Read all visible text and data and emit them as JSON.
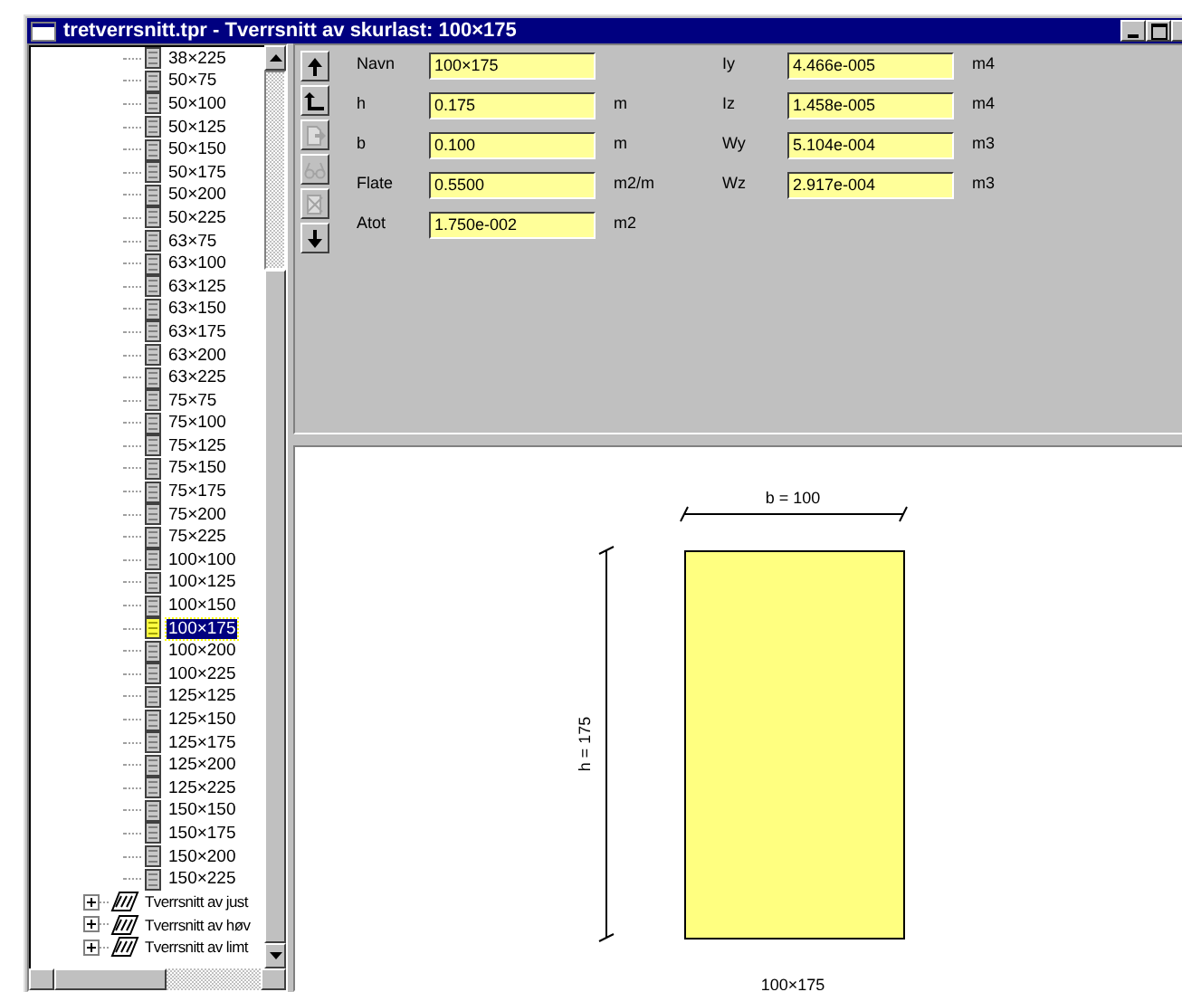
{
  "window": {
    "title": "tretverrsnitt.tpr - Tverrsnitt av skurlast: 100×175"
  },
  "sections": [
    {
      "label": "38×225",
      "selected": false
    },
    {
      "label": "50×75",
      "selected": false
    },
    {
      "label": "50×100",
      "selected": false
    },
    {
      "label": "50×125",
      "selected": false
    },
    {
      "label": "50×150",
      "selected": false
    },
    {
      "label": "50×175",
      "selected": false
    },
    {
      "label": "50×200",
      "selected": false
    },
    {
      "label": "50×225",
      "selected": false
    },
    {
      "label": "63×75",
      "selected": false
    },
    {
      "label": "63×100",
      "selected": false
    },
    {
      "label": "63×125",
      "selected": false
    },
    {
      "label": "63×150",
      "selected": false
    },
    {
      "label": "63×175",
      "selected": false
    },
    {
      "label": "63×200",
      "selected": false
    },
    {
      "label": "63×225",
      "selected": false
    },
    {
      "label": "75×75",
      "selected": false
    },
    {
      "label": "75×100",
      "selected": false
    },
    {
      "label": "75×125",
      "selected": false
    },
    {
      "label": "75×150",
      "selected": false
    },
    {
      "label": "75×175",
      "selected": false
    },
    {
      "label": "75×200",
      "selected": false
    },
    {
      "label": "75×225",
      "selected": false
    },
    {
      "label": "100×100",
      "selected": false
    },
    {
      "label": "100×125",
      "selected": false
    },
    {
      "label": "100×150",
      "selected": false
    },
    {
      "label": "100×175",
      "selected": true
    },
    {
      "label": "100×200",
      "selected": false
    },
    {
      "label": "100×225",
      "selected": false
    },
    {
      "label": "125×125",
      "selected": false
    },
    {
      "label": "125×150",
      "selected": false
    },
    {
      "label": "125×175",
      "selected": false
    },
    {
      "label": "125×200",
      "selected": false
    },
    {
      "label": "125×225",
      "selected": false
    },
    {
      "label": "150×150",
      "selected": false
    },
    {
      "label": "150×175",
      "selected": false
    },
    {
      "label": "150×200",
      "selected": false
    },
    {
      "label": "150×225",
      "selected": false
    }
  ],
  "folders": [
    {
      "label": "Tverrsnitt av just",
      "expanded": false
    },
    {
      "label": "Tverrsnitt av høv",
      "expanded": false
    },
    {
      "label": "Tverrsnitt av limt",
      "expanded": false
    }
  ],
  "toolbar": [
    {
      "kind": "up",
      "disabled": false
    },
    {
      "kind": "return",
      "disabled": false
    },
    {
      "kind": "export",
      "disabled": true
    },
    {
      "kind": "glasses",
      "disabled": true
    },
    {
      "kind": "delete",
      "disabled": true
    },
    {
      "kind": "down",
      "disabled": false
    }
  ],
  "fields_left": [
    {
      "label": "Navn",
      "value": "100×175"
    },
    {
      "label": "h",
      "value": "0.175",
      "unit": "m"
    },
    {
      "label": "b",
      "value": "0.100",
      "unit": "m"
    },
    {
      "label": "Flate",
      "value": "0.5500",
      "unit": "m2/m"
    },
    {
      "label": "Atot",
      "value": "1.750e-002",
      "unit": "m2"
    }
  ],
  "fields_right": [
    {
      "label": "Iy",
      "value": "4.466e-005",
      "unit": "m4"
    },
    {
      "label": "Iz",
      "value": "1.458e-005",
      "unit": "m4"
    },
    {
      "label": "Wy",
      "value": "5.104e-004",
      "unit": "m3"
    },
    {
      "label": "Wz",
      "value": "2.917e-004",
      "unit": "m3"
    }
  ],
  "drawing": {
    "width_label": "b = 100",
    "height_label": "h = 175",
    "caption": "100×175"
  }
}
